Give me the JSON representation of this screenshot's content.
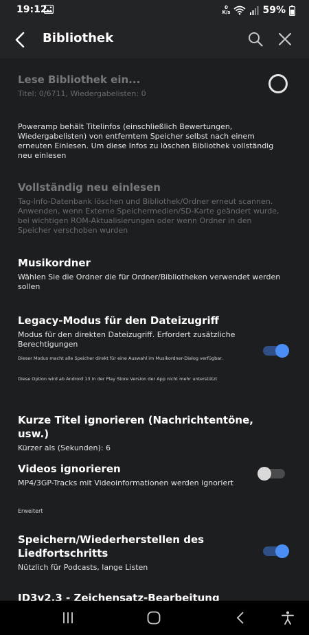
{
  "status_bar": {
    "time": "19:12",
    "net_speed_top": "0",
    "net_speed_unit": "K/s",
    "battery": "59%"
  },
  "app_bar": {
    "title": "Bibliothek"
  },
  "rescan": {
    "title": "Lese Bibliothek ein...",
    "subtitle": "Titel: 0/6711, Wiedergabelisten: 0"
  },
  "info_text": "Poweramp behält Titelinfos (einschließlich Bewertungen, Wiedergabelisten) von entferntem Speicher selbst nach einem erneuten Einlesen. Um diese Infos zu löschen Bibliothek vollständig neu einlesen",
  "full_rescan": {
    "title": "Vollständig neu einlesen",
    "subtitle": "Tag-Info-Datenbank löschen und Bibliothek/Ordner erneut scannen. Anwenden, wenn Externe Speichermedien/SD-Karte geändert wurde, bei wichtigen ROM-Aktualisierungen oder wenn Ordner in den Speicher verschoben wurden"
  },
  "music_folders": {
    "title": "Musikordner",
    "subtitle": "Wählen Sie die Ordner die für Ordner/Bibliotheken verwendet werden sollen"
  },
  "legacy_mode": {
    "title": "Legacy-Modus für den Dateizugriff",
    "subtitle": "Modus für den direkten Dateizugriff. Erfordert zusätzliche Berechtigungen",
    "note1": "Dieser Modus macht alle Speicher direkt für eine Auswahl im Musikordner-Dialog verfügbar.",
    "note2": "Diese Option wird ab Android 13 in der Play Store Version der App nicht mehr unterstützt",
    "enabled": true
  },
  "short_titles": {
    "title": "Kurze Titel ignorieren (Nachrichtentöne, usw.)",
    "subtitle": "Kürzer als (Sekunden): 6"
  },
  "ignore_videos": {
    "title": "Videos ignorieren",
    "subtitle": "MP4/3GP-Tracks mit Videoinformationen werden ignoriert",
    "enabled": false
  },
  "section_advanced": "Erweitert",
  "save_progress": {
    "title": "Speichern/Wiederherstellen des Liedfortschritts",
    "subtitle": "Nützlich für Podcasts, lange Listen",
    "enabled": true
  },
  "next_item_partial": "ID3v2.3 - Zeichensatz-Bearbeitung",
  "icons": {
    "back": "back-arrow-icon",
    "search": "search-icon",
    "close": "close-icon",
    "nav_recents": "recents-icon",
    "nav_home": "home-icon",
    "nav_back": "nav-back-icon",
    "nav_accessibility": "accessibility-icon"
  },
  "colors": {
    "accent": "#4a8ef5",
    "background": "#1d1e20",
    "appbar": "#232426"
  }
}
